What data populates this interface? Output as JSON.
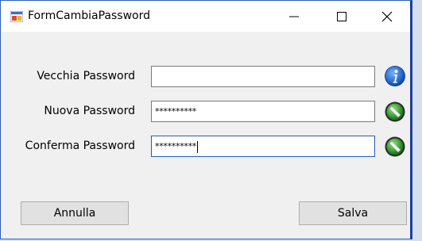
{
  "window": {
    "title": "FormCambiaPassword",
    "controls": {
      "minimize": "—",
      "maximize": "☐",
      "close": "✕"
    }
  },
  "form": {
    "old_password": {
      "label": "Vecchia Password",
      "value": "",
      "icon": "info-icon"
    },
    "new_password": {
      "label": "Nuova Password",
      "value": "**********",
      "icon": "green-ok-icon"
    },
    "confirm_password": {
      "label": "Conferma Password",
      "value": "**********",
      "icon": "green-ok-icon"
    }
  },
  "buttons": {
    "cancel": "Annulla",
    "save": "Salva"
  },
  "colors": {
    "accent": "#2b5fb8",
    "info_blue": "#1b63c9",
    "ok_green": "#1f8a24"
  }
}
